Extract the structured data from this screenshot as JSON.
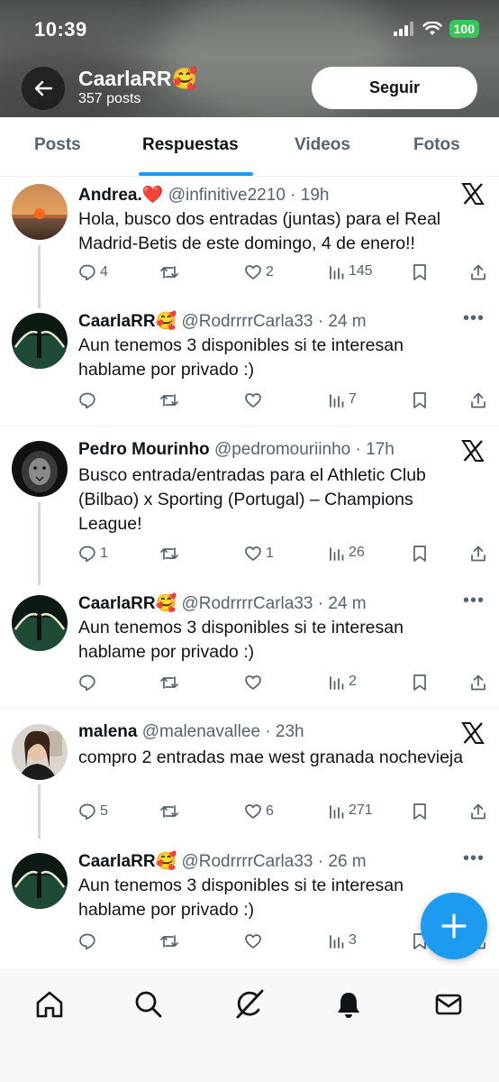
{
  "status_bar": {
    "time": "10:39",
    "battery": "100"
  },
  "profile": {
    "name": "CaarlaRR🥰",
    "posts_count": "357 posts",
    "follow_label": "Seguir"
  },
  "tabs": [
    {
      "label": "Posts"
    },
    {
      "label": "Respuestas",
      "active": true
    },
    {
      "label": "Videos"
    },
    {
      "label": "Fotos"
    }
  ],
  "posts": [
    {
      "name": "Andrea.❤️",
      "handle": "@infinitive2210",
      "time": "· 19h",
      "text": "Hola, busco dos entradas (juntas) para el Real Madrid-Betis de este domingo, 4 de enero!!",
      "replies": "4",
      "retweets": "",
      "likes": "2",
      "views": "145",
      "corner": "x-logo",
      "avatar": "sunset"
    },
    {
      "name": "CaarlaRR🥰",
      "handle": "@RodrrrrCarla33",
      "time": "· 24 m",
      "text": "Aun tenemos 3 disponibles si te interesan hablame por privado :)",
      "replies": "",
      "retweets": "",
      "likes": "",
      "views": "7",
      "corner": "more",
      "avatar": "fountain"
    },
    {
      "name": "Pedro Mourinho",
      "handle": "@pedromouriinho",
      "time": "· 17h",
      "text": "Busco entrada/entradas para el Athletic Club (Bilbao) x Sporting (Portugal) – Champions League!",
      "replies": "1",
      "retweets": "",
      "likes": "1",
      "views": "26",
      "corner": "x-logo",
      "avatar": "lion"
    },
    {
      "name": "CaarlaRR🥰",
      "handle": "@RodrrrrCarla33",
      "time": "· 24 m",
      "text": "Aun tenemos 3 disponibles si te interesan hablame por privado :)",
      "replies": "",
      "retweets": "",
      "likes": "",
      "views": "2",
      "corner": "more",
      "avatar": "fountain"
    },
    {
      "name": "malena",
      "handle": "@malenavallee",
      "time": "· 23h",
      "text": "compro 2 entradas mae west granada nochevieja",
      "replies": "5",
      "retweets": "",
      "likes": "6",
      "views": "271",
      "corner": "x-logo",
      "avatar": "selfie"
    },
    {
      "name": "CaarlaRR🥰",
      "handle": "@RodrrrrCarla33",
      "time": "· 26 m",
      "text": "Aun tenemos 3 disponibles si te interesan hablame por privado :)",
      "replies": "",
      "retweets": "",
      "likes": "",
      "views": "3",
      "corner": "more",
      "avatar": "fountain"
    }
  ],
  "bottom_nav": [
    {
      "icon": "home-icon"
    },
    {
      "icon": "search-icon"
    },
    {
      "icon": "grok-icon"
    },
    {
      "icon": "bell-icon"
    },
    {
      "icon": "mail-icon"
    }
  ],
  "colors": {
    "accent": "#1d9bf0",
    "text": "#0f1419",
    "muted": "#536471",
    "border": "#eff3f4"
  }
}
